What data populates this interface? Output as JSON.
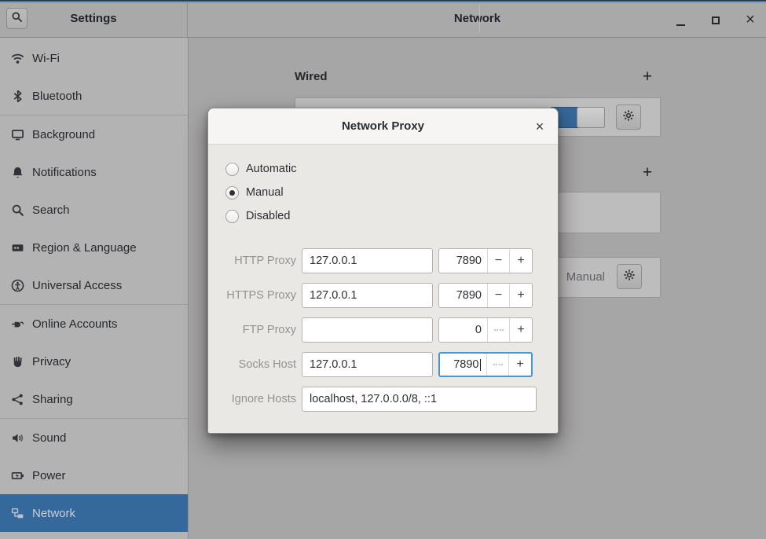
{
  "header": {
    "app_title": "Settings",
    "page_title": "Network"
  },
  "icons": {
    "close_glyph": "×",
    "dialog_close_glyph": "×",
    "add_glyph": "+",
    "minus_glyph": "−",
    "plus_glyph": "+"
  },
  "sidebar": {
    "items": [
      {
        "icon": "wifi-icon",
        "label": "Wi-Fi"
      },
      {
        "icon": "bluetooth-icon",
        "label": "Bluetooth"
      },
      {
        "icon": "background-icon",
        "label": "Background"
      },
      {
        "icon": "notifications-icon",
        "label": "Notifications"
      },
      {
        "icon": "search-icon",
        "label": "Search"
      },
      {
        "icon": "region-language-icon",
        "label": "Region & Language"
      },
      {
        "icon": "universal-access-icon",
        "label": "Universal Access"
      },
      {
        "icon": "online-accounts-icon",
        "label": "Online Accounts"
      },
      {
        "icon": "privacy-icon",
        "label": "Privacy"
      },
      {
        "icon": "sharing-icon",
        "label": "Sharing"
      },
      {
        "icon": "sound-icon",
        "label": "Sound"
      },
      {
        "icon": "power-icon",
        "label": "Power"
      },
      {
        "icon": "network-icon",
        "label": "Network",
        "selected": true
      }
    ]
  },
  "content": {
    "wired_title": "Wired",
    "proxy_status": "Manual",
    "wired_switch_on": true
  },
  "dialog": {
    "title": "Network Proxy",
    "modes": [
      {
        "label": "Automatic",
        "selected": false
      },
      {
        "label": "Manual",
        "selected": true
      },
      {
        "label": "Disabled",
        "selected": false
      }
    ],
    "rows": [
      {
        "label": "HTTP Proxy",
        "host": "127.0.0.1",
        "port": "7890",
        "minus_disabled": false,
        "focused": false
      },
      {
        "label": "HTTPS Proxy",
        "host": "127.0.0.1",
        "port": "7890",
        "minus_disabled": false,
        "focused": false
      },
      {
        "label": "FTP Proxy",
        "host": "",
        "port": "0",
        "minus_disabled": true,
        "focused": false
      },
      {
        "label": "Socks Host",
        "host": "127.0.0.1",
        "port": "7890",
        "minus_disabled": true,
        "focused": true
      }
    ],
    "ignore_label": "Ignore Hosts",
    "ignore_value": "localhost, 127.0.0.0/8, ::1"
  },
  "colors": {
    "selection_blue": "#35689b",
    "focus_blue": "#4695d8",
    "switch_on_blue": "#36689a",
    "dialog_bg": "#e9e8e5",
    "backdrop_gray": "#a6a6a6"
  }
}
